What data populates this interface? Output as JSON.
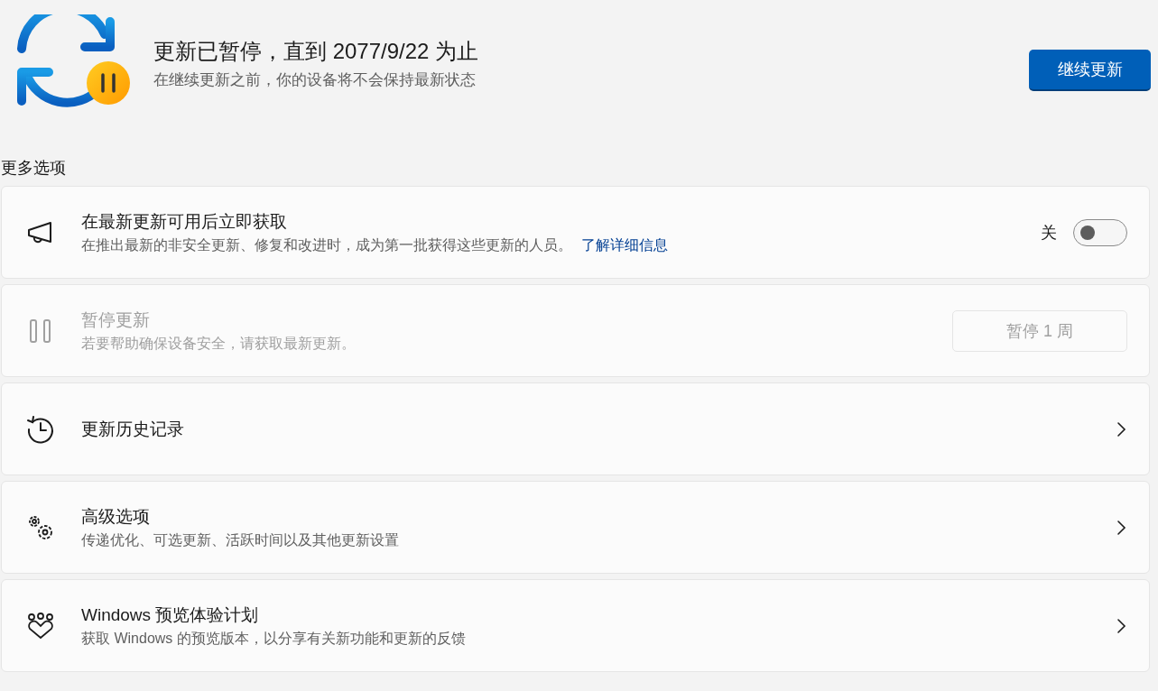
{
  "header": {
    "title": "更新已暂停，直到 2077/9/22 为止",
    "subtitle": "在继续更新之前，你的设备将不会保持最新状态",
    "button": "继续更新"
  },
  "section_title": "更多选项",
  "options": [
    {
      "kind": "toggle",
      "title": "在最新更新可用后立即获取",
      "description": "在推出最新的非安全更新、修复和改进时，成为第一批获得这些更新的人员。",
      "link": "了解详细信息",
      "toggle_label": "关",
      "on": false,
      "disabled": false
    },
    {
      "kind": "button",
      "title": "暂停更新",
      "description": "若要帮助确保设备安全，请获取最新更新。",
      "button": "暂停 1 周",
      "disabled": true
    },
    {
      "kind": "chevron",
      "title": "更新历史记录",
      "disabled": false
    },
    {
      "kind": "chevron",
      "title": "高级选项",
      "description": "传递优化、可选更新、活跃时间以及其他更新设置",
      "disabled": false
    },
    {
      "kind": "chevron",
      "title": "Windows 预览体验计划",
      "description": "获取 Windows 的预览版本，以分享有关新功能和更新的反馈",
      "disabled": false
    }
  ]
}
